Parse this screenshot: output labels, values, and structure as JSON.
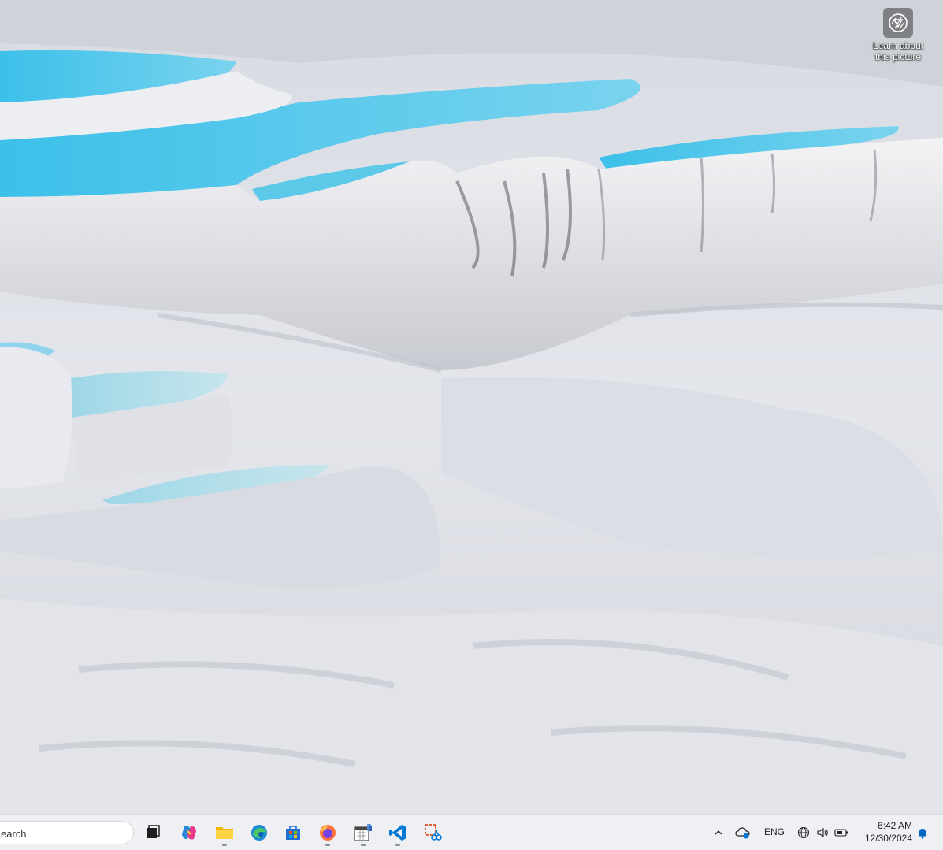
{
  "desktop": {
    "spotlight": {
      "label_line1": "Learn about",
      "label_line2": "this picture",
      "icon": "camera-aperture-icon"
    }
  },
  "taskbar": {
    "search": {
      "value": "earch",
      "placeholder": "Search"
    },
    "apps": [
      {
        "name": "task-view",
        "icon": "task-view-icon"
      },
      {
        "name": "copilot",
        "icon": "copilot-icon"
      },
      {
        "name": "file-explorer",
        "icon": "folder-icon",
        "running": true
      },
      {
        "name": "edge",
        "icon": "edge-icon"
      },
      {
        "name": "store",
        "icon": "store-icon"
      },
      {
        "name": "firefox",
        "icon": "firefox-icon",
        "running": true
      },
      {
        "name": "calendar-app",
        "icon": "calendar-icon",
        "running": true
      },
      {
        "name": "vscode",
        "icon": "vscode-icon",
        "running": true
      },
      {
        "name": "snipping-tool",
        "icon": "snipping-tool-icon"
      }
    ],
    "tray": {
      "language": "ENG",
      "time": "6:42 AM",
      "date": "12/30/2024"
    }
  },
  "colors": {
    "taskbar_bg": "#eef0f4",
    "water": "#4fc3e6",
    "travertine": "#e6e8ee",
    "accent_blue": "#0067c0"
  }
}
